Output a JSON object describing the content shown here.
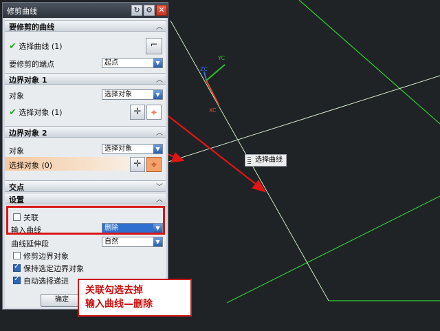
{
  "dialog": {
    "title": "修剪曲线",
    "sections": {
      "curve": {
        "header": "要修剪的曲线",
        "select_label": "选择曲线 (1)",
        "end_label": "要修剪的端点",
        "end_value": "起点"
      },
      "boundary1": {
        "header": "边界对象 1",
        "object_label": "对象",
        "object_value": "选择对象",
        "select_label": "选择对象 (1)"
      },
      "boundary2": {
        "header": "边界对象 2",
        "object_label": "对象",
        "object_value": "选择对象",
        "select_label": "选择对象 (0)"
      },
      "intersection": {
        "header": "交点"
      },
      "settings": {
        "header": "设置",
        "associative_label": "关联",
        "associative_checked": false,
        "input_curve_label": "输入曲线",
        "input_curve_value": "删除",
        "extension_label": "曲线延伸段",
        "extension_value": "自然",
        "trim_boundary_label": "修剪边界对象",
        "trim_boundary_checked": false,
        "keep_boundary_label": "保持选定边界对象",
        "keep_boundary_checked": true,
        "auto_select_label": "自动选择递进",
        "auto_select_checked": true
      }
    },
    "ok_label": "确定"
  },
  "viewport": {
    "tooltip": "选择曲线",
    "axis_labels": {
      "zc": "ZC",
      "yc": "YC",
      "xc": "XC"
    }
  },
  "annotation": {
    "line1": "关联勾选去掉",
    "line2": "输入曲线—删除"
  },
  "colors": {
    "viewport_bg": "#1f2326",
    "curve": "#2fd12f",
    "annotation_red": "#d91616",
    "selection_orange": "#f5c8a0"
  }
}
